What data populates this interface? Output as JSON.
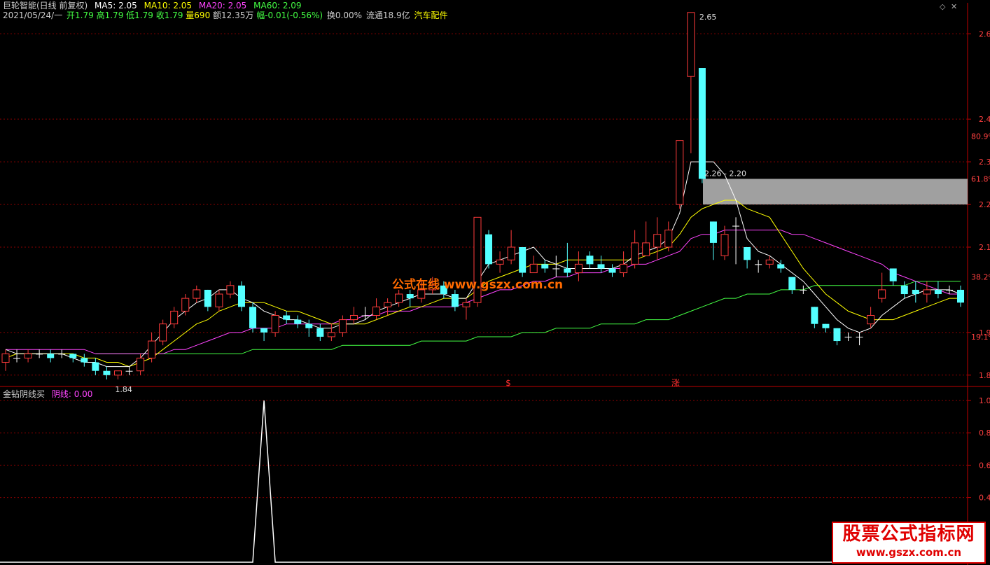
{
  "header": {
    "stock_name": "巨轮智能(日线 前复权)",
    "ma5": "MA5: 2.05",
    "ma10": "MA10: 2.05",
    "ma20": "MA20: 2.05",
    "ma60": "MA60: 2.09",
    "date": "2021/05/24/一",
    "open": "开1.79",
    "high": "高1.79",
    "low": "低1.79",
    "close": "收1.79",
    "volume": "量690",
    "amount": "额12.35万",
    "change": "幅-0.01(-0.56%)",
    "turnover": "换0.00%",
    "float": "流通18.9亿",
    "sector": "汽车配件"
  },
  "indicator": {
    "name": "金钻阴线买",
    "value_label": "阴线: 0.00"
  },
  "watermark_mid": "公式在线 www.gszx.com.cn",
  "watermark_corner": {
    "line1": "股票公式指标网",
    "line2": "www.gszx.com.cn"
  },
  "colors": {
    "up": "#ff3b3b",
    "down": "#54ffff",
    "ma5": "#ffffff",
    "ma10": "#ffff00",
    "ma20": "#ff44ff",
    "ma60": "#44ff44",
    "grid": "#8b0000",
    "axis": "#c00000"
  },
  "chart_data": [
    {
      "type": "candlestick",
      "ylim": [
        1.78,
        2.63
      ],
      "y_ticks": [
        {
          "value": 2.6,
          "label": "2.6"
        },
        {
          "value": 2.4,
          "label": "2.4"
        },
        {
          "value": 2.3,
          "label": "2.3"
        },
        {
          "value": 2.2,
          "label": "2.2"
        },
        {
          "value": 2.1,
          "label": "2.1"
        },
        {
          "value": 1.9,
          "label": "1.9"
        },
        {
          "value": 1.8,
          "label": "1.8"
        }
      ],
      "pct_ticks": [
        {
          "value": 2.36,
          "label": "80.9%"
        },
        {
          "value": 2.26,
          "label": "61.8%"
        },
        {
          "value": 2.03,
          "label": "38.2%"
        },
        {
          "value": 1.89,
          "label": "19.1%"
        }
      ],
      "annotations": {
        "high_label": "2.65",
        "low_label": "1.84",
        "zone_label": "2.26 - 2.20",
        "zone": [
          2.2,
          2.26
        ],
        "markers": [
          "$",
          "涨"
        ]
      },
      "candles": [
        [
          1.83,
          1.85,
          1.86,
          1.81
        ],
        [
          1.84,
          1.84,
          1.86,
          1.83
        ],
        [
          1.84,
          1.85,
          1.86,
          1.83
        ],
        [
          1.85,
          1.85,
          1.86,
          1.84
        ],
        [
          1.85,
          1.84,
          1.86,
          1.83
        ],
        [
          1.85,
          1.85,
          1.86,
          1.84
        ],
        [
          1.85,
          1.84,
          1.85,
          1.83
        ],
        [
          1.84,
          1.83,
          1.85,
          1.82
        ],
        [
          1.83,
          1.81,
          1.84,
          1.8
        ],
        [
          1.81,
          1.8,
          1.82,
          1.79
        ],
        [
          1.8,
          1.81,
          1.81,
          1.79
        ],
        [
          1.81,
          1.81,
          1.82,
          1.8
        ],
        [
          1.81,
          1.84,
          1.85,
          1.8
        ],
        [
          1.84,
          1.88,
          1.9,
          1.83
        ],
        [
          1.88,
          1.92,
          1.93,
          1.87
        ],
        [
          1.92,
          1.95,
          1.96,
          1.91
        ],
        [
          1.95,
          1.98,
          1.99,
          1.94
        ],
        [
          1.98,
          2.0,
          2.01,
          1.97
        ],
        [
          2.0,
          1.96,
          2.0,
          1.95
        ],
        [
          1.96,
          1.99,
          2.0,
          1.95
        ],
        [
          1.99,
          2.01,
          2.02,
          1.98
        ],
        [
          2.01,
          1.96,
          2.02,
          1.95
        ],
        [
          1.96,
          1.91,
          1.97,
          1.9
        ],
        [
          1.91,
          1.9,
          1.91,
          1.88
        ],
        [
          1.9,
          1.94,
          1.95,
          1.89
        ],
        [
          1.94,
          1.93,
          1.95,
          1.92
        ],
        [
          1.93,
          1.92,
          1.94,
          1.91
        ],
        [
          1.92,
          1.91,
          1.93,
          1.89
        ],
        [
          1.91,
          1.89,
          1.92,
          1.88
        ],
        [
          1.89,
          1.9,
          1.92,
          1.88
        ],
        [
          1.9,
          1.93,
          1.94,
          1.89
        ],
        [
          1.93,
          1.94,
          1.96,
          1.92
        ],
        [
          1.94,
          1.94,
          1.96,
          1.93
        ],
        [
          1.94,
          1.96,
          1.98,
          1.93
        ],
        [
          1.96,
          1.97,
          1.98,
          1.94
        ],
        [
          1.97,
          1.99,
          2.0,
          1.96
        ],
        [
          1.99,
          1.98,
          2.0,
          1.96
        ],
        [
          1.98,
          2.0,
          2.02,
          1.97
        ],
        [
          2.0,
          2.01,
          2.03,
          1.99
        ],
        [
          2.01,
          1.99,
          2.02,
          1.98
        ],
        [
          1.99,
          1.96,
          2.0,
          1.95
        ],
        [
          1.96,
          1.97,
          1.98,
          1.93
        ],
        [
          1.97,
          2.17,
          2.17,
          1.96
        ],
        [
          2.13,
          2.06,
          2.14,
          2.05
        ],
        [
          2.06,
          2.07,
          2.09,
          2.04
        ],
        [
          2.07,
          2.1,
          2.14,
          2.06
        ],
        [
          2.1,
          2.04,
          2.1,
          2.03
        ],
        [
          2.04,
          2.06,
          2.08,
          2.04
        ],
        [
          2.06,
          2.05,
          2.07,
          2.04
        ],
        [
          2.05,
          2.05,
          2.08,
          2.03
        ],
        [
          2.05,
          2.04,
          2.11,
          2.03
        ],
        [
          2.04,
          2.06,
          2.09,
          2.02
        ],
        [
          2.08,
          2.06,
          2.09,
          2.05
        ],
        [
          2.06,
          2.05,
          2.08,
          2.04
        ],
        [
          2.05,
          2.04,
          2.06,
          2.03
        ],
        [
          2.04,
          2.06,
          2.09,
          2.03
        ],
        [
          2.06,
          2.11,
          2.14,
          2.05
        ],
        [
          2.08,
          2.11,
          2.16,
          2.08
        ],
        [
          2.1,
          2.13,
          2.17,
          2.07
        ],
        [
          2.1,
          2.14,
          2.16,
          2.09
        ],
        [
          2.2,
          2.35,
          2.29,
          2.19
        ],
        [
          2.5,
          2.65,
          2.65,
          2.32
        ],
        [
          2.52,
          2.26,
          2.52,
          2.25
        ],
        [
          2.16,
          2.11,
          2.16,
          2.07
        ],
        [
          2.08,
          2.13,
          2.15,
          2.07
        ],
        [
          2.15,
          2.15,
          2.17,
          2.06
        ],
        [
          2.1,
          2.07,
          2.1,
          2.05
        ],
        [
          2.06,
          2.06,
          2.07,
          2.04
        ],
        [
          2.06,
          2.07,
          2.08,
          2.05
        ],
        [
          2.06,
          2.05,
          2.07,
          2.04
        ],
        [
          2.03,
          2.0,
          2.03,
          1.99
        ],
        [
          2.0,
          2.0,
          2.01,
          1.99
        ],
        [
          1.96,
          1.92,
          1.96,
          1.91
        ],
        [
          1.92,
          1.91,
          1.92,
          1.9
        ],
        [
          1.91,
          1.88,
          1.91,
          1.87
        ],
        [
          1.89,
          1.89,
          1.9,
          1.88
        ],
        [
          1.89,
          1.89,
          1.9,
          1.87
        ],
        [
          1.92,
          1.94,
          1.96,
          1.91
        ],
        [
          1.98,
          2.0,
          2.04,
          1.97
        ],
        [
          2.05,
          2.02,
          2.05,
          2.01
        ],
        [
          2.01,
          1.99,
          2.02,
          1.98
        ],
        [
          2.0,
          1.99,
          2.02,
          1.97
        ],
        [
          1.99,
          2.0,
          2.02,
          1.97
        ],
        [
          2.0,
          1.99,
          2.02,
          1.98
        ],
        [
          2.0,
          2.0,
          2.01,
          1.99
        ],
        [
          2.0,
          1.97,
          2.01,
          1.96
        ]
      ],
      "ma5": [
        1.86,
        1.85,
        1.85,
        1.85,
        1.85,
        1.85,
        1.84,
        1.83,
        1.83,
        1.82,
        1.82,
        1.82,
        1.84,
        1.87,
        1.9,
        1.93,
        1.95,
        1.97,
        1.98,
        2.0,
        2.0,
        1.98,
        1.97,
        1.95,
        1.94,
        1.93,
        1.93,
        1.92,
        1.91,
        1.91,
        1.92,
        1.92,
        1.93,
        1.95,
        1.96,
        1.97,
        1.98,
        1.99,
        1.99,
        1.99,
        1.98,
        1.98,
        2.02,
        2.06,
        2.07,
        2.08,
        2.09,
        2.1,
        2.07,
        2.06,
        2.05,
        2.05,
        2.05,
        2.05,
        2.05,
        2.06,
        2.08,
        2.09,
        2.1,
        2.12,
        2.18,
        2.3,
        2.3,
        2.3,
        2.27,
        2.21,
        2.12,
        2.09,
        2.08,
        2.06,
        2.04,
        2.02,
        1.99,
        1.96,
        1.93,
        1.91,
        1.9,
        1.91,
        1.94,
        1.96,
        1.98,
        1.99,
        2.0,
        2.0,
        2.0,
        1.99
      ],
      "ma10": [
        1.84,
        1.85,
        1.85,
        1.85,
        1.85,
        1.85,
        1.85,
        1.84,
        1.84,
        1.83,
        1.83,
        1.82,
        1.83,
        1.84,
        1.86,
        1.88,
        1.9,
        1.92,
        1.93,
        1.95,
        1.96,
        1.97,
        1.97,
        1.97,
        1.96,
        1.95,
        1.95,
        1.94,
        1.93,
        1.92,
        1.92,
        1.92,
        1.92,
        1.93,
        1.94,
        1.95,
        1.96,
        1.96,
        1.97,
        1.98,
        1.98,
        1.98,
        2.0,
        2.02,
        2.03,
        2.04,
        2.05,
        2.06,
        2.06,
        2.06,
        2.07,
        2.07,
        2.07,
        2.07,
        2.07,
        2.07,
        2.07,
        2.08,
        2.09,
        2.1,
        2.13,
        2.17,
        2.19,
        2.2,
        2.21,
        2.21,
        2.19,
        2.18,
        2.17,
        2.13,
        2.09,
        2.05,
        2.02,
        1.99,
        1.97,
        1.95,
        1.94,
        1.93,
        1.93,
        1.93,
        1.94,
        1.95,
        1.96,
        1.97,
        1.98,
        1.98
      ],
      "ma20": [
        1.86,
        1.86,
        1.86,
        1.86,
        1.86,
        1.86,
        1.86,
        1.86,
        1.85,
        1.85,
        1.85,
        1.85,
        1.85,
        1.85,
        1.85,
        1.86,
        1.86,
        1.87,
        1.88,
        1.89,
        1.9,
        1.9,
        1.91,
        1.91,
        1.91,
        1.92,
        1.92,
        1.92,
        1.92,
        1.92,
        1.93,
        1.93,
        1.94,
        1.94,
        1.95,
        1.95,
        1.95,
        1.96,
        1.96,
        1.96,
        1.96,
        1.97,
        1.98,
        1.99,
        2.0,
        2.0,
        2.01,
        2.02,
        2.02,
        2.03,
        2.03,
        2.04,
        2.04,
        2.04,
        2.05,
        2.05,
        2.06,
        2.06,
        2.07,
        2.08,
        2.09,
        2.12,
        2.13,
        2.13,
        2.14,
        2.14,
        2.14,
        2.14,
        2.14,
        2.14,
        2.13,
        2.13,
        2.12,
        2.11,
        2.1,
        2.09,
        2.08,
        2.07,
        2.06,
        2.04,
        2.03,
        2.02,
        2.01,
        2.0,
        1.99,
        1.99
      ],
      "ma60": [
        null,
        null,
        null,
        null,
        null,
        null,
        null,
        null,
        1.85,
        1.85,
        1.85,
        1.85,
        1.85,
        1.85,
        1.85,
        1.85,
        1.85,
        1.85,
        1.85,
        1.85,
        1.85,
        1.85,
        1.86,
        1.86,
        1.86,
        1.86,
        1.86,
        1.86,
        1.86,
        1.86,
        1.87,
        1.87,
        1.87,
        1.87,
        1.87,
        1.87,
        1.87,
        1.88,
        1.88,
        1.88,
        1.88,
        1.88,
        1.89,
        1.89,
        1.89,
        1.89,
        1.9,
        1.9,
        1.9,
        1.91,
        1.91,
        1.91,
        1.91,
        1.92,
        1.92,
        1.92,
        1.92,
        1.93,
        1.93,
        1.93,
        1.94,
        1.95,
        1.96,
        1.97,
        1.98,
        1.98,
        1.99,
        1.99,
        1.99,
        2.0,
        2.0,
        2.0,
        2.01,
        2.01,
        2.01,
        2.01,
        2.01,
        2.01,
        2.01,
        2.01,
        2.01,
        2.02,
        2.02,
        2.02,
        2.02,
        2.02
      ]
    },
    {
      "type": "line",
      "ylim": [
        0,
        1.0
      ],
      "y_ticks": [
        {
          "value": 1.0,
          "label": "1.0"
        },
        {
          "value": 0.8,
          "label": "0.8"
        },
        {
          "value": 0.6,
          "label": "0.6"
        },
        {
          "value": 0.4,
          "label": "0.4"
        }
      ],
      "spike_index": 23,
      "spike_value": 1.0
    }
  ]
}
